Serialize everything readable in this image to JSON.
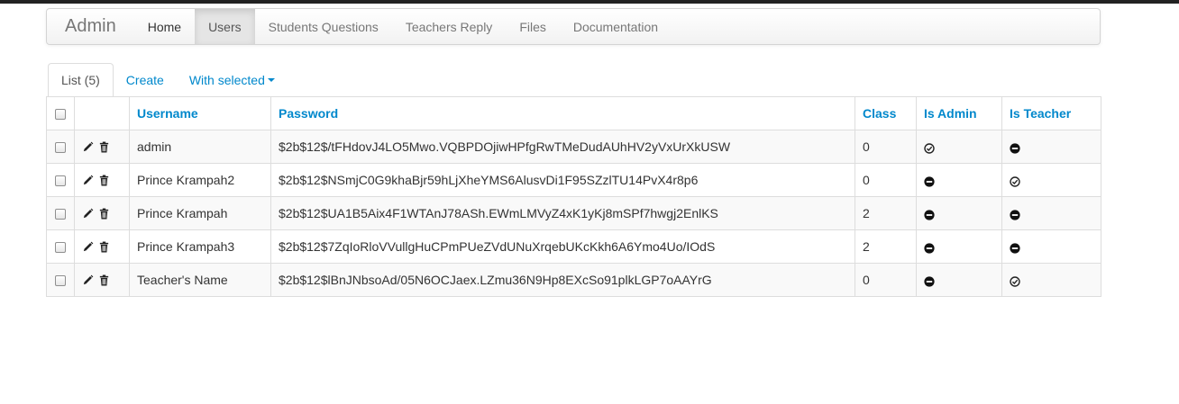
{
  "navbar": {
    "brand": "Admin",
    "items": [
      {
        "label": "Home"
      },
      {
        "label": "Users"
      },
      {
        "label": "Students Questions"
      },
      {
        "label": "Teachers Reply"
      },
      {
        "label": "Files"
      },
      {
        "label": "Documentation"
      }
    ],
    "active": "Users"
  },
  "tabs": {
    "list": "List (5)",
    "create": "Create",
    "with_selected": "With selected"
  },
  "table": {
    "columns": [
      "Username",
      "Password",
      "Class",
      "Is Admin",
      "Is Teacher"
    ],
    "rows": [
      {
        "username": "admin",
        "password": "$2b$12$/tFHdovJ4LO5Mwo.VQBPDOjiwHPfgRwTMeDudAUhHV2yVxUrXkUSW",
        "class": "0",
        "is_admin": "check-circle-icon",
        "is_teacher": "minus-circle-icon"
      },
      {
        "username": "Prince Krampah2",
        "password": "$2b$12$NSmjC0G9khaBjr59hLjXheYMS6AlusvDi1F95SZzlTU14PvX4r8p6",
        "class": "0",
        "is_admin": "minus-circle-icon",
        "is_teacher": "check-circle-icon"
      },
      {
        "username": "Prince Krampah",
        "password": "$2b$12$UA1B5Aix4F1WTAnJ78ASh.EWmLMVyZ4xK1yKj8mSPf7hwgj2EnlKS",
        "class": "2",
        "is_admin": "minus-circle-icon",
        "is_teacher": "minus-circle-icon"
      },
      {
        "username": "Prince Krampah3",
        "password": "$2b$12$7ZqIoRloVVullgHuCPmPUeZVdUNuXrqebUKcKkh6A6Ymo4Uo/IOdS",
        "class": "2",
        "is_admin": "minus-circle-icon",
        "is_teacher": "minus-circle-icon"
      },
      {
        "username": "Teacher's Name",
        "password": "$2b$12$lBnJNbsoAd/05N6OCJaex.LZmu36N9Hp8EXcSo91plkLGP7oAAYrG",
        "class": "0",
        "is_admin": "minus-circle-icon",
        "is_teacher": "check-circle-icon"
      }
    ]
  }
}
